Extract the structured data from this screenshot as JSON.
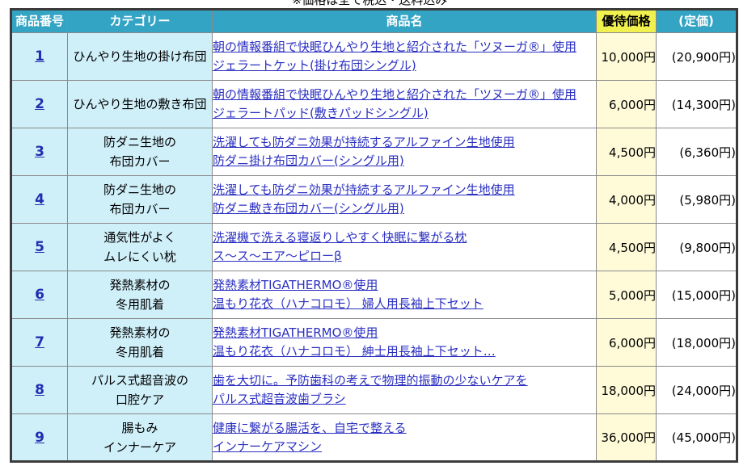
{
  "top_note": "※価格は全て税込・送料込み",
  "headers": {
    "number": "商品番号",
    "category": "カテゴリー",
    "name": "商品名",
    "price": "優待価格",
    "list_price": "(定価)"
  },
  "colors": {
    "header_bg": "#33a4c4",
    "price_header_bg": "#f0f04e",
    "category_bg": "#cfeff9",
    "price_bg": "#fffbd9",
    "link": "#2a2fc0"
  },
  "rows": [
    {
      "number": "1",
      "category_line1": "ひんやり生地の掛け布団",
      "category_line2": "",
      "name_line1": "朝の情報番組で快眠ひんやり生地と紹介された「ツヌーガ®」使用",
      "name_line2": "ジェラートケット(掛け布団シングル)",
      "price": "10,000円",
      "list_price": "(20,900円)"
    },
    {
      "number": "2",
      "category_line1": "ひんやり生地の敷き布団",
      "category_line2": "",
      "name_line1": "朝の情報番組で快眠ひんやり生地と紹介された「ツヌーガ®」使用",
      "name_line2": "ジェラートパッド(敷きパッドシングル)",
      "price": "6,000円",
      "list_price": "(14,300円)"
    },
    {
      "number": "3",
      "category_line1": "防ダニ生地の",
      "category_line2": "布団カバー",
      "name_line1": "洗濯しても防ダニ効果が持続するアルファイン生地使用",
      "name_line2": "防ダニ掛け布団カバー(シングル用)",
      "price": "4,500円",
      "list_price": "(6,360円)"
    },
    {
      "number": "4",
      "category_line1": "防ダニ生地の",
      "category_line2": "布団カバー",
      "name_line1": "洗濯しても防ダニ効果が持続するアルファイン生地使用",
      "name_line2": "防ダニ敷き布団カバー(シングル用)",
      "price": "4,000円",
      "list_price": "(5,980円)"
    },
    {
      "number": "5",
      "category_line1": "通気性がよく",
      "category_line2": "ムレにくい枕",
      "name_line1": "洗濯機で洗える寝返りしやすく快眠に繋がる枕",
      "name_line2": "ス〜ス〜エア〜ピローβ",
      "price": "4,500円",
      "list_price": "(9,800円)"
    },
    {
      "number": "6",
      "category_line1": "発熱素材の",
      "category_line2": "冬用肌着",
      "name_line1": "発熱素材TIGATHERMO®使用",
      "name_line2": "温もり花衣（ハナコロモ） 婦人用長袖上下セット",
      "price": "5,000円",
      "list_price": "(15,000円)"
    },
    {
      "number": "7",
      "category_line1": "発熱素材の",
      "category_line2": "冬用肌着",
      "name_line1": "発熱素材TIGATHERMO®使用",
      "name_line2": "温もり花衣（ハナコロモ） 紳士用長袖上下セット…",
      "price": "6,000円",
      "list_price": "(18,000円)"
    },
    {
      "number": "8",
      "category_line1": "パルス式超音波の",
      "category_line2": "口腔ケア",
      "name_line1": "歯を大切に。予防歯科の考えで物理的振動の少ないケアを",
      "name_line2": "パルス式超音波歯ブラシ",
      "price": "18,000円",
      "list_price": "(24,000円)"
    },
    {
      "number": "9",
      "category_line1": "腸もみ",
      "category_line2": "インナーケア",
      "name_line1": "健康に繋がる腸活を、自宅で整える",
      "name_line2": "インナーケアマシン",
      "price": "36,000円",
      "list_price": "(45,000円)"
    }
  ]
}
